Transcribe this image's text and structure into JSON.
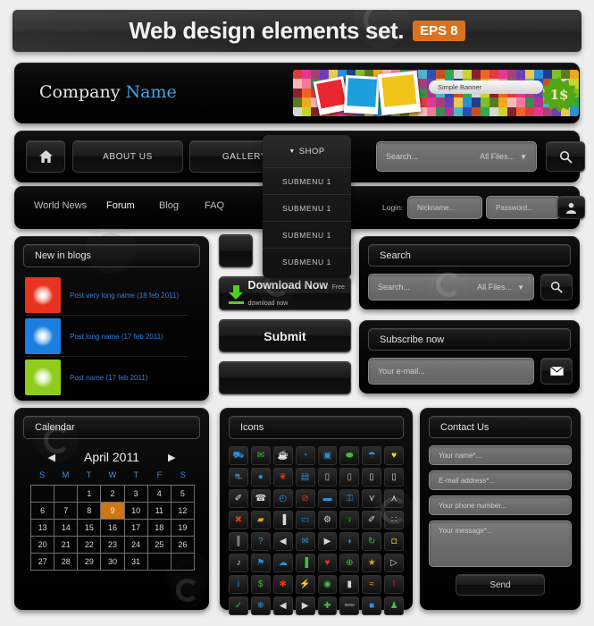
{
  "title_bar": {
    "text": "Web design elements set.",
    "badge": "EPS 8",
    "badge_color": "#d9721e"
  },
  "company": {
    "name_plain": "Company",
    "name_accent": "Name",
    "accent_color": "#3ea6e8",
    "banner_pill": "Simple Banner",
    "price_label": "1$"
  },
  "main_nav": {
    "home_icon": "home-icon",
    "buttons": [
      {
        "label": "ABOUT US"
      },
      {
        "label": "GALLERY"
      }
    ],
    "search_placeholder": "Search...",
    "filter_label": "All Files...",
    "search_icon": "magnifier-icon"
  },
  "shop_menu": {
    "label": "SHOP",
    "caret": "▼",
    "items": [
      "SUBMENU 1",
      "SUBMENU 1",
      "SUBMENU 1",
      "SUBMENU 1"
    ]
  },
  "sub_nav": {
    "links": [
      "World News",
      "Forum",
      "Blog",
      "FAQ"
    ],
    "active": "Forum",
    "login_label": "Login:",
    "nickname_placeholder": "Nickname...",
    "password_placeholder": "Password...",
    "login_icon": "user-icon"
  },
  "blogs": {
    "header": "New in blogs",
    "posts": [
      {
        "title": "Post very long name (18 feb 2011)",
        "color": "#e8331f"
      },
      {
        "title": "Post long name (17 feb 2011)",
        "color": "#1b7fe0"
      },
      {
        "title": "Post name (17 feb 2011)",
        "color": "#8fcc1d"
      }
    ],
    "link_color": "#2f7fd8"
  },
  "mid_buttons": {
    "download_title": "Download Now",
    "download_subtitle": "Free download now",
    "download_icon": "download-arrow-icon",
    "download_icon_color": "#4fd11a",
    "submit_label": "Submit",
    "blank_label": ""
  },
  "search_widget": {
    "title": "Search",
    "placeholder": "Search...",
    "filter_label": "All Files...",
    "button_icon": "magnifier-icon"
  },
  "subscribe_widget": {
    "title": "Subscribe now",
    "placeholder": "Your e-mail...",
    "button_icon": "envelope-icon"
  },
  "calendar": {
    "header": "Calendar",
    "month": "April 2011",
    "prev_icon": "arrow-left-icon",
    "next_icon": "arrow-right-icon",
    "dow": [
      "S",
      "M",
      "T",
      "W",
      "T",
      "F",
      "S"
    ],
    "dow_color": "#3d8fd6",
    "highlight_color": "#cf7516",
    "today": 9,
    "cells": [
      "",
      "",
      "1",
      "2",
      "3",
      "4",
      "5",
      "6",
      "7",
      "8",
      "9",
      "10",
      "11",
      "12",
      "13",
      "14",
      "15",
      "16",
      "17",
      "18",
      "19",
      "20",
      "21",
      "22",
      "23",
      "24",
      "25",
      "26",
      "27",
      "28",
      "29",
      "30",
      "31",
      "",
      ""
    ]
  },
  "icons_widget": {
    "header": "Icons",
    "icons": [
      {
        "name": "cart-icon",
        "glyph": "Ὥ2",
        "ch": "⛟",
        "color": "#2f8ed6"
      },
      {
        "name": "mail-icon",
        "ch": "✉",
        "color": "#3fbf3f"
      },
      {
        "name": "coffee-icon",
        "ch": "☕",
        "color": "#d8d8d8"
      },
      {
        "name": "pie-chart-icon",
        "ch": "◔",
        "color": "#2f8ed6"
      },
      {
        "name": "media-player-icon",
        "ch": "▣",
        "color": "#2f8ed6"
      },
      {
        "name": "mouse-icon",
        "ch": "⬬",
        "color": "#3fbf3f"
      },
      {
        "name": "umbrella-icon",
        "ch": "☂",
        "color": "#2f8ed6"
      },
      {
        "name": "heart-badge-icon",
        "ch": "♥",
        "color": "#e8e81a"
      },
      {
        "name": "car-icon",
        "ch": "⛐",
        "color": "#2f8ed6"
      },
      {
        "name": "water-drop-icon",
        "ch": "●",
        "color": "#2f8ed6"
      },
      {
        "name": "flame-icon",
        "ch": "❦",
        "color": "#e03a1a"
      },
      {
        "name": "book-icon",
        "ch": "▤",
        "color": "#2f8ed6"
      },
      {
        "name": "battery-icon",
        "ch": "▯",
        "color": "#c8c8c8"
      },
      {
        "name": "battery-half-icon",
        "ch": "▯",
        "color": "#b0b0b0"
      },
      {
        "name": "battery-low-icon",
        "ch": "▯",
        "color": "#d0d0d0"
      },
      {
        "name": "battery-empty-icon",
        "ch": "▯",
        "color": "#d0d0d0"
      },
      {
        "name": "pen-icon",
        "ch": "✐",
        "color": "#e0e0e0"
      },
      {
        "name": "phone-icon",
        "ch": "☎",
        "color": "#d8d8d8"
      },
      {
        "name": "clock-icon",
        "ch": "◴",
        "color": "#2f8ed6"
      },
      {
        "name": "forbidden-icon",
        "ch": "⊘",
        "color": "#e03a1a"
      },
      {
        "name": "briefcase-icon",
        "ch": "▬",
        "color": "#2f8ed6"
      },
      {
        "name": "lock-icon",
        "ch": "⚿",
        "color": "#2f8ed6"
      },
      {
        "name": "double-down-icon",
        "ch": "⋎",
        "color": "#d8d8d8"
      },
      {
        "name": "double-up-icon",
        "ch": "⋏",
        "color": "#d8d8d8"
      },
      {
        "name": "close-icon",
        "ch": "✖",
        "color": "#e03a1a"
      },
      {
        "name": "folder-icon",
        "ch": "▰",
        "color": "#e0a31a"
      },
      {
        "name": "pause-icon",
        "ch": "▐",
        "color": "#d8d8d8"
      },
      {
        "name": "chat-bubble-icon",
        "ch": "▭",
        "color": "#2f8ed6"
      },
      {
        "name": "gear-icon",
        "ch": "⚙",
        "color": "#d8d8d8"
      },
      {
        "name": "pin-icon",
        "ch": "♀",
        "color": "#3fbf3f"
      },
      {
        "name": "microphone-icon",
        "ch": "✐",
        "color": "#d8d8d8"
      },
      {
        "name": "apps-grid-icon",
        "ch": "∷",
        "color": "#d8d8d8"
      },
      {
        "name": "sliders-icon",
        "ch": "║",
        "color": "#d8d8d8"
      },
      {
        "name": "help-icon",
        "ch": "?",
        "color": "#2f8ed6"
      },
      {
        "name": "volume-icon",
        "ch": "◀",
        "color": "#d8d8d8"
      },
      {
        "name": "envelope-open-icon",
        "ch": "✉",
        "color": "#2f8ed6"
      },
      {
        "name": "play-icon",
        "ch": "▶",
        "color": "#d8d8d8"
      },
      {
        "name": "browser-icon",
        "ch": "◖",
        "color": "#2f8ed6"
      },
      {
        "name": "refresh-icon",
        "ch": "↻",
        "color": "#3fbf3f"
      },
      {
        "name": "bulb-icon",
        "ch": "◘",
        "color": "#e0a31a"
      },
      {
        "name": "music-note-icon",
        "ch": "♪",
        "color": "#d8d8d8"
      },
      {
        "name": "tag-icon",
        "ch": "⚑",
        "color": "#2f8ed6"
      },
      {
        "name": "cloud-icon",
        "ch": "☁",
        "color": "#2f8ed6"
      },
      {
        "name": "bar-chart-icon",
        "ch": "▐",
        "color": "#3fbf3f"
      },
      {
        "name": "heart-icon",
        "ch": "♥",
        "color": "#e03a1a"
      },
      {
        "name": "globe-icon",
        "ch": "⊕",
        "color": "#3fbf3f"
      },
      {
        "name": "star-icon",
        "ch": "★",
        "color": "#e0a31a"
      },
      {
        "name": "video-camera-icon",
        "ch": "▷",
        "color": "#d8d8d8"
      },
      {
        "name": "info-icon",
        "ch": "i",
        "color": "#2f8ed6"
      },
      {
        "name": "dollar-icon",
        "ch": "$",
        "color": "#3fbf3f"
      },
      {
        "name": "asterisk-icon",
        "ch": "✱",
        "color": "#e03a1a"
      },
      {
        "name": "lightning-icon",
        "ch": "⚡",
        "color": "#d8d8d8"
      },
      {
        "name": "eye-icon",
        "ch": "◉",
        "color": "#3fbf3f"
      },
      {
        "name": "trash-icon",
        "ch": "▮",
        "color": "#d8d8d8"
      },
      {
        "name": "rss-icon",
        "ch": "≈",
        "color": "#e0a31a"
      },
      {
        "name": "exclamation-icon",
        "ch": "!",
        "color": "#e03a1a"
      },
      {
        "name": "check-icon",
        "ch": "✓",
        "color": "#3fbf3f"
      },
      {
        "name": "snowflake-icon",
        "ch": "❄",
        "color": "#2f8ed6"
      },
      {
        "name": "arrow-left-icon",
        "ch": "◀",
        "color": "#d8d8d8"
      },
      {
        "name": "arrow-right-icon",
        "ch": "▶",
        "color": "#d8d8d8"
      },
      {
        "name": "plus-icon",
        "ch": "✚",
        "color": "#3fbf3f"
      },
      {
        "name": "minus-icon",
        "ch": "➖",
        "color": "#e03a1a"
      },
      {
        "name": "save-icon",
        "ch": "■",
        "color": "#2f8ed6"
      },
      {
        "name": "user-icon",
        "ch": "♟",
        "color": "#3fbf3f"
      }
    ]
  },
  "contact": {
    "header": "Contact Us",
    "name_placeholder": "Your name*...",
    "email_placeholder": "E-mail address*...",
    "phone_placeholder": "Your phone number...",
    "message_placeholder": "Your message*...",
    "send_label": "Send"
  }
}
